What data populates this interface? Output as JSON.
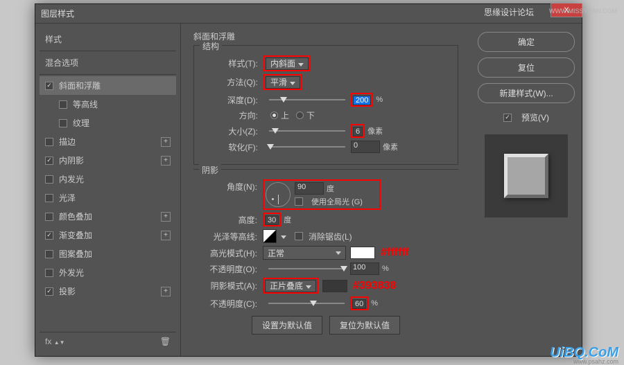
{
  "dialog": {
    "title": "图层样式",
    "close": "X"
  },
  "sidebar": {
    "header_styles": "样式",
    "header_blend": "混合选项",
    "items": [
      {
        "label": "斜面和浮雕",
        "checked": true,
        "active": true,
        "has_plus": false
      },
      {
        "label": "等高线",
        "checked": false,
        "sub": true
      },
      {
        "label": "纹理",
        "checked": false,
        "sub": true
      },
      {
        "label": "描边",
        "checked": false,
        "has_plus": true
      },
      {
        "label": "内阴影",
        "checked": true,
        "has_plus": true
      },
      {
        "label": "内发光",
        "checked": false
      },
      {
        "label": "光泽",
        "checked": false
      },
      {
        "label": "颜色叠加",
        "checked": false,
        "has_plus": true
      },
      {
        "label": "渐变叠加",
        "checked": true,
        "has_plus": true
      },
      {
        "label": "图案叠加",
        "checked": false
      },
      {
        "label": "外发光",
        "checked": false
      },
      {
        "label": "投影",
        "checked": true,
        "has_plus": true
      }
    ],
    "footer_fx": "fx",
    "footer_trash": "🗑"
  },
  "main": {
    "title": "斜面和浮雕",
    "structure": {
      "label": "结构",
      "style_label": "样式(T):",
      "style_value": "内斜面",
      "method_label": "方法(Q):",
      "method_value": "平滑",
      "depth_label": "深度(D):",
      "depth_value": "200",
      "depth_unit": "%",
      "direction_label": "方向:",
      "dir_up": "上",
      "dir_down": "下",
      "size_label": "大小(Z):",
      "size_value": "6",
      "size_unit": "像素",
      "soften_label": "软化(F):",
      "soften_value": "0",
      "soften_unit": "像素"
    },
    "shading": {
      "label": "阴影",
      "angle_label": "角度(N):",
      "angle_value": "90",
      "angle_unit": "度",
      "global_light": "使用全局光 (G)",
      "altitude_label": "高度:",
      "altitude_value": "30",
      "altitude_unit": "度",
      "gloss_label": "光泽等高线:",
      "antialias": "消除锯齿(L)",
      "highlight_mode_label": "高光模式(H):",
      "highlight_mode_value": "正常",
      "highlight_color": "#ffffff",
      "highlight_annot": "#ffffff",
      "highlight_opacity_label": "不透明度(O):",
      "highlight_opacity_value": "100",
      "highlight_opacity_unit": "%",
      "shadow_mode_label": "阴影模式(A):",
      "shadow_mode_value": "正片叠底",
      "shadow_color": "#393838",
      "shadow_annot": "#393838",
      "shadow_opacity_label": "不透明度(C):",
      "shadow_opacity_value": "60",
      "shadow_opacity_unit": "%"
    },
    "buttons": {
      "make_default": "设置为默认值",
      "reset_default": "复位为默认值"
    }
  },
  "right": {
    "ok": "确定",
    "reset": "复位",
    "new_style": "新建样式(W)...",
    "preview": "预览(V)"
  },
  "watermarks": {
    "forum": "思缘设计论坛",
    "url1": "WWW.MISSYUAN.COM",
    "logo": "UiBQ.CoM",
    "url2": "www.psahz.com"
  }
}
